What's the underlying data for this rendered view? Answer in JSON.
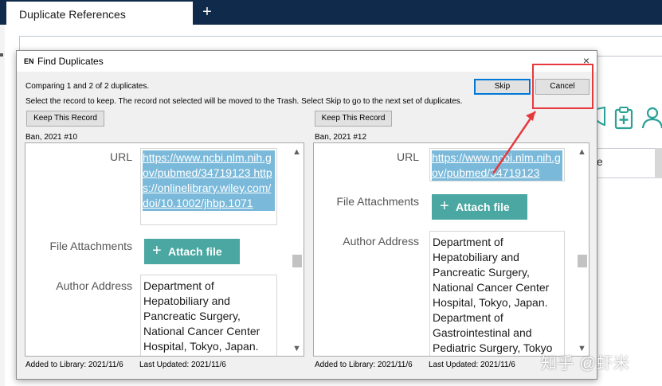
{
  "app": {
    "tab_title": "Duplicate References",
    "add_tab_label": "+",
    "right_column_text": "e"
  },
  "dialog": {
    "badge": "EN",
    "title": "Find Duplicates",
    "close_label": "×",
    "message_line1": "Comparing 1 and 2 of 2 duplicates.",
    "message_line2": "Select the record to keep. The record not selected will be moved to the Trash. Select Skip to go to the next set of duplicates.",
    "skip_label": "Skip",
    "cancel_label": "Cancel"
  },
  "records": [
    {
      "keep_label": "Keep This Record",
      "label": "Ban, 2021 #10",
      "url_label": "URL",
      "url_text": "https://www.ncbi.nlm.nih.gov/pubmed/34719123 https://onlinelibrary.wiley.com/doi/10.1002/jhbp.1071",
      "attachments_label": "File Attachments",
      "attach_button": "Attach file",
      "author_address_label": "Author Address",
      "author_address": "Department of Hepatobiliary and Pancreatic Surgery, National Cancer Center Hospital, Tokyo, Japan.",
      "added": "Added to Library: 2021/11/6",
      "updated": "Last Updated: 2021/11/6"
    },
    {
      "keep_label": "Keep This Record",
      "label": "Ban, 2021 #12",
      "url_label": "URL",
      "url_text": "https://www.ncbi.nlm.nih.gov/pubmed/34719123",
      "attachments_label": "File Attachments",
      "attach_button": "Attach file",
      "author_address_label": "Author Address",
      "author_address": "Department of Hepatobiliary and Pancreatic Surgery, National Cancer Center Hospital, Tokyo, Japan. Department of Gastrointestinal and Pediatric Surgery, Tokyo",
      "added": "Added to Library: 2021/11/6",
      "updated": "Last Updated: 2021/11/6"
    }
  ],
  "watermark": "知乎 @虾米",
  "colors": {
    "titlebar": "#0f2a4a",
    "selection": "#7ab9da",
    "attach_button": "#4aa7a1",
    "annotation": "#e5393e",
    "app_icons": "#2aa198"
  },
  "icons": {
    "right_icons": [
      "shield-icon",
      "clipboard-plus-icon",
      "user-icon"
    ],
    "plus": "+"
  }
}
